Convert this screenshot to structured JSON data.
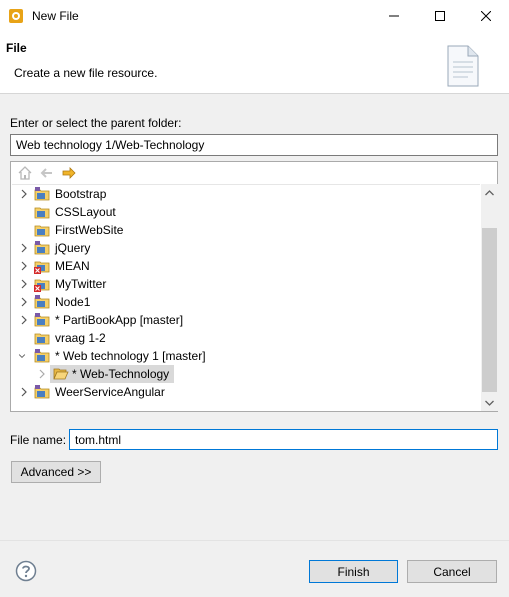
{
  "window": {
    "title": "New File"
  },
  "header": {
    "title": "File",
    "description": "Create a new file resource."
  },
  "folder": {
    "label": "Enter or select the parent folder:",
    "value": "Web technology 1/Web-Technology"
  },
  "tree": {
    "items": [
      {
        "label": "Bootstrap",
        "expandable": true,
        "level": 0
      },
      {
        "label": "CSSLayout",
        "expandable": false,
        "level": 0
      },
      {
        "label": "FirstWebSite",
        "expandable": false,
        "level": 0
      },
      {
        "label": "jQuery",
        "expandable": true,
        "level": 0
      },
      {
        "label": "MEAN",
        "expandable": true,
        "level": 0,
        "error": true
      },
      {
        "label": "MyTwitter",
        "expandable": true,
        "level": 0,
        "error": true
      },
      {
        "label": "Node1",
        "expandable": true,
        "level": 0
      },
      {
        "label": "* PartiBookApp [master]",
        "expandable": true,
        "level": 0
      },
      {
        "label": "vraag 1-2",
        "expandable": false,
        "level": 0
      },
      {
        "label": "* Web technology 1 [master]",
        "expandable": true,
        "expanded": true,
        "level": 0
      },
      {
        "label": "* Web-Technology",
        "expandable": true,
        "level": 1,
        "selected": true
      },
      {
        "label": "WeerServiceAngular",
        "expandable": true,
        "level": 0
      }
    ]
  },
  "filename": {
    "label": "File name:",
    "value": "tom.html"
  },
  "buttons": {
    "advanced": "Advanced >>",
    "finish": "Finish",
    "cancel": "Cancel"
  },
  "icons": {
    "app": "eclipse-gear-icon",
    "file_wizard": "document-wizard-icon",
    "home": "home-icon",
    "back": "back-arrow-icon",
    "forward": "forward-arrow-icon",
    "project": "project-folder-icon",
    "folder": "open-folder-icon",
    "help": "help-icon"
  },
  "colors": {
    "accent": "#0078d7",
    "selection": "#d9d9d9",
    "forward_arrow": "#e8a317"
  }
}
